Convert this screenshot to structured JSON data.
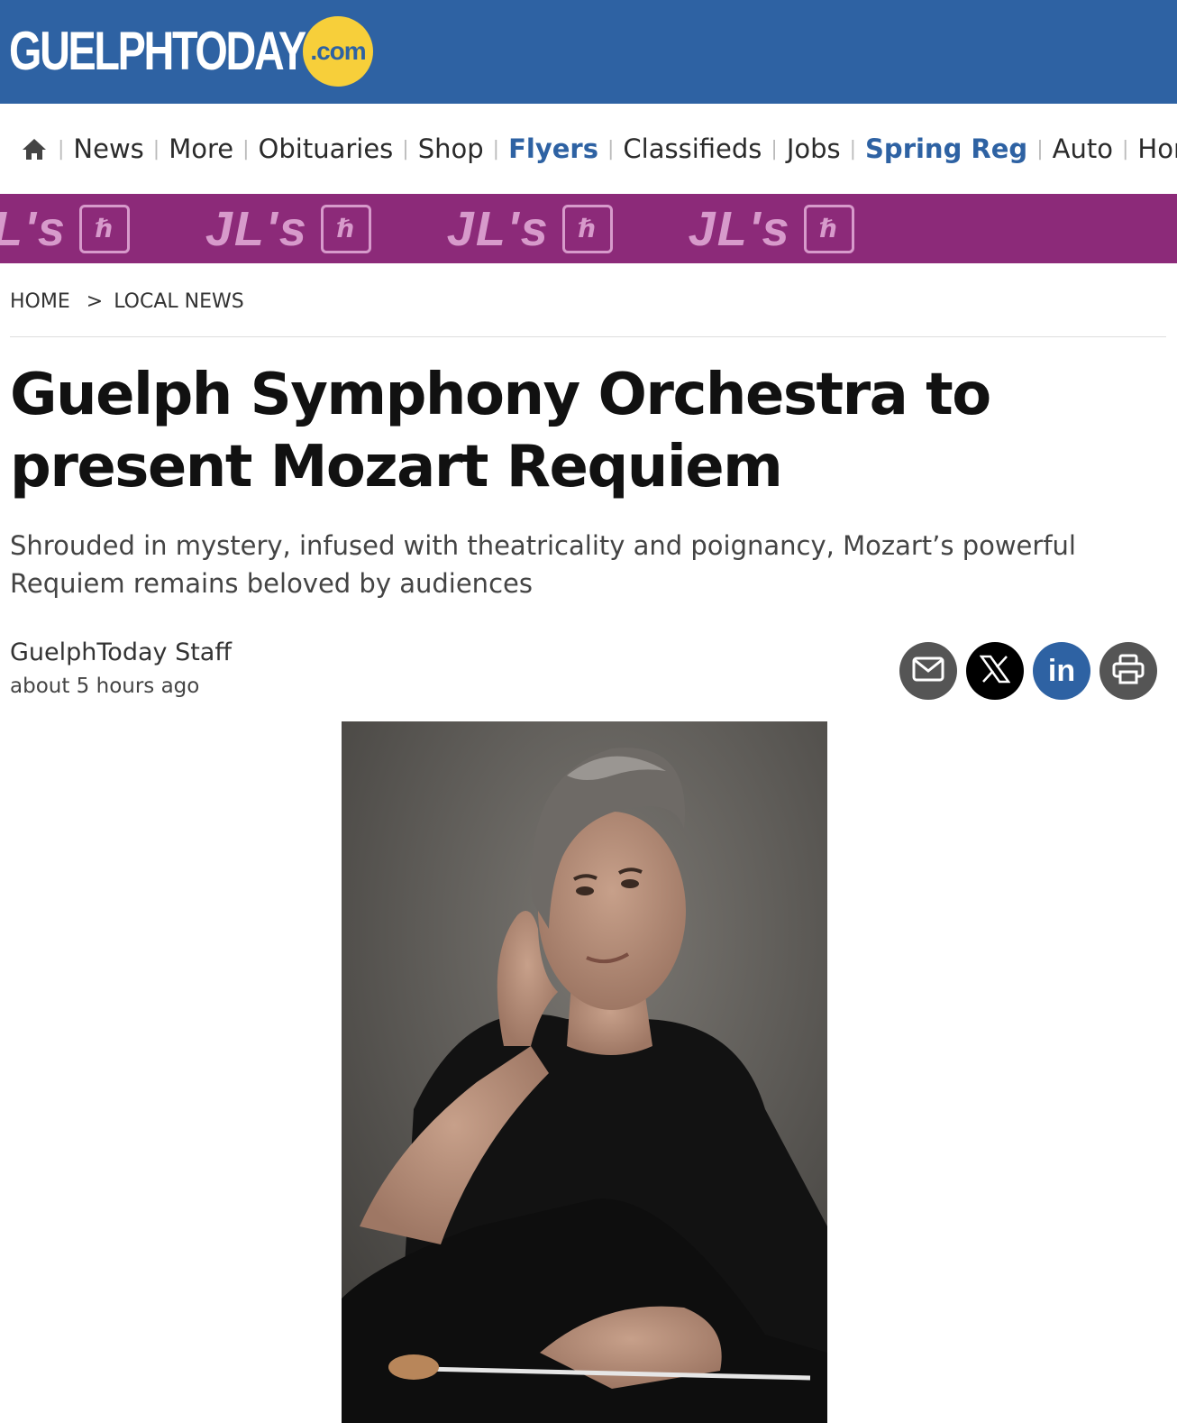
{
  "site": {
    "logo_text": "GUELPHTODAY",
    "logo_suffix": ".com"
  },
  "nav": {
    "items": [
      {
        "label": "News",
        "highlight": false
      },
      {
        "label": "More",
        "highlight": false
      },
      {
        "label": "Obituaries",
        "highlight": false
      },
      {
        "label": "Shop",
        "highlight": false
      },
      {
        "label": "Flyers",
        "highlight": true
      },
      {
        "label": "Classifieds",
        "highlight": false
      },
      {
        "label": "Jobs",
        "highlight": false
      },
      {
        "label": "Spring Reg",
        "highlight": true
      },
      {
        "label": "Auto",
        "highlight": false
      },
      {
        "label": "Hom",
        "highlight": false
      }
    ]
  },
  "banner": {
    "text": "JL's"
  },
  "breadcrumb": {
    "home": "HOME",
    "separator": ">",
    "section": "LOCAL NEWS"
  },
  "article": {
    "title": "Guelph Symphony Orchestra to present Mozart Requiem",
    "subtitle": "Shrouded in mystery, infused with theatricality and poignancy, Mozart’s powerful Requiem remains beloved by audiences",
    "author": "GuelphToday Staff",
    "time": "about 5 hours ago"
  },
  "share": {
    "icons": [
      "email-icon",
      "x-icon",
      "linkedin-icon",
      "print-icon"
    ],
    "colors": {
      "email": "#555555",
      "x": "#000000",
      "linkedin": "#2e62a3",
      "print": "#555555"
    }
  },
  "colors": {
    "header_bg": "#2e62a3",
    "logo_circle": "#f7cf3a",
    "banner_bg": "#8c2a79",
    "nav_highlight": "#2e62a3"
  }
}
